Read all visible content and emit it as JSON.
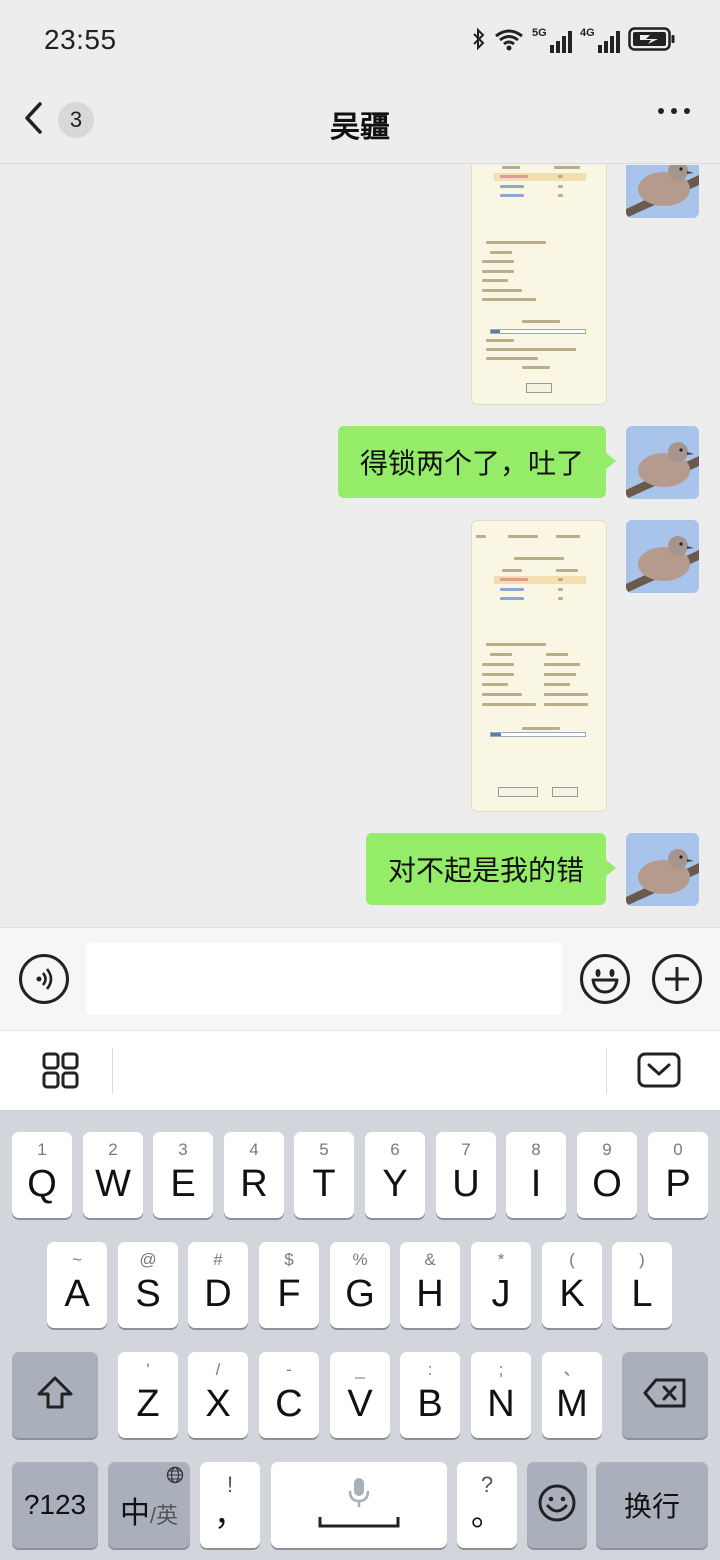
{
  "status_bar": {
    "time": "23:55",
    "icons": [
      "bluetooth-icon",
      "wifi-icon",
      "signal-5g-icon",
      "signal-4g-icon",
      "battery-charging-icon"
    ],
    "net1": "5G",
    "net2": "4G"
  },
  "nav": {
    "title": "吴疆",
    "unread_count": "3"
  },
  "messages": [
    {
      "type": "image",
      "side": "right",
      "description": "game-screenshot-1"
    },
    {
      "type": "text",
      "side": "right",
      "text": "得锁两个了，吐了"
    },
    {
      "type": "image",
      "side": "right",
      "description": "game-screenshot-2"
    },
    {
      "type": "text",
      "side": "right",
      "text": "对不起是我的错"
    }
  ],
  "input": {
    "value": "",
    "placeholder": ""
  },
  "keyboard": {
    "row1": [
      {
        "hint": "1",
        "key": "Q"
      },
      {
        "hint": "2",
        "key": "W"
      },
      {
        "hint": "3",
        "key": "E"
      },
      {
        "hint": "4",
        "key": "R"
      },
      {
        "hint": "5",
        "key": "T"
      },
      {
        "hint": "6",
        "key": "Y"
      },
      {
        "hint": "7",
        "key": "U"
      },
      {
        "hint": "8",
        "key": "I"
      },
      {
        "hint": "9",
        "key": "O"
      },
      {
        "hint": "0",
        "key": "P"
      }
    ],
    "row2": [
      {
        "hint": "~",
        "key": "A"
      },
      {
        "hint": "@",
        "key": "S"
      },
      {
        "hint": "#",
        "key": "D"
      },
      {
        "hint": "$",
        "key": "F"
      },
      {
        "hint": "%",
        "key": "G"
      },
      {
        "hint": "&",
        "key": "H"
      },
      {
        "hint": "*",
        "key": "J"
      },
      {
        "hint": "(",
        "key": "K"
      },
      {
        "hint": ")",
        "key": "L"
      }
    ],
    "row3": [
      {
        "hint": "'",
        "key": "Z"
      },
      {
        "hint": "/",
        "key": "X"
      },
      {
        "hint": "-",
        "key": "C"
      },
      {
        "hint": "_",
        "key": "V"
      },
      {
        "hint": ":",
        "key": "B"
      },
      {
        "hint": ";",
        "key": "N"
      },
      {
        "hint": "、",
        "key": "M"
      }
    ],
    "numbers_label": "?123",
    "lang_main": "中",
    "lang_alt": "/英",
    "comma_hint": "!",
    "comma_key": "，",
    "period_hint": "?",
    "period_key": "。",
    "enter_label": "换行"
  },
  "colors": {
    "bubble": "#95ec69",
    "background": "#ededed",
    "keyboard": "#d2d5dc"
  }
}
